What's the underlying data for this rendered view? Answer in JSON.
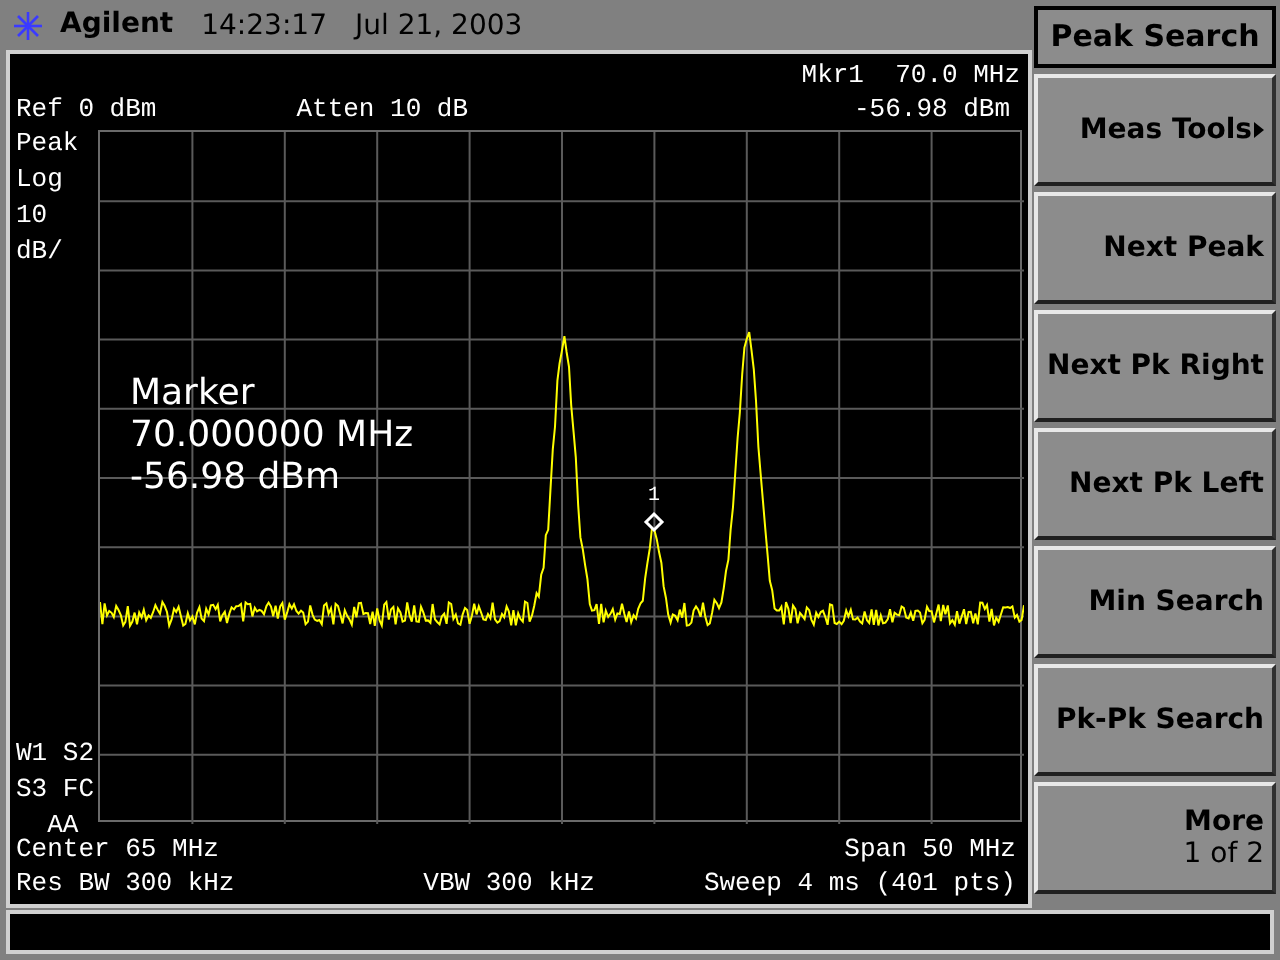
{
  "header": {
    "brand": "Agilent",
    "time": "14:23:17",
    "date": "Jul 21, 2003"
  },
  "display": {
    "marker_top": "Mkr1  70.0 MHz",
    "ref": "Ref 0 dBm",
    "atten": "Atten 10 dB",
    "marker_amplitude": "-56.98 dBm",
    "left_labels": [
      "Peak",
      "Log",
      "10",
      "dB/"
    ],
    "status_labels": [
      "W1 S2",
      "S3 FC",
      "  AA"
    ],
    "marker_readout": [
      "Marker",
      "70.000000 MHz",
      "-56.98 dBm"
    ],
    "marker": {
      "label": "1"
    },
    "center": "Center 65 MHz",
    "span": "Span 50 MHz",
    "res_bw": "Res BW 300 kHz",
    "vbw": "VBW 300 kHz",
    "sweep": "Sweep 4 ms (401 pts)"
  },
  "softkeys": {
    "title": "Peak Search",
    "keys": [
      {
        "label": "Meas Tools",
        "kind": "submenu"
      },
      {
        "label": "Next Peak",
        "kind": "plain"
      },
      {
        "label": "Next Pk Right",
        "kind": "plain"
      },
      {
        "label": "Next Pk Left",
        "kind": "plain"
      },
      {
        "label": "Min Search",
        "kind": "plain"
      },
      {
        "label": "Pk-Pk Search",
        "kind": "plain"
      },
      {
        "label": "More",
        "kind": "more",
        "sublabel": "1 of 2"
      }
    ]
  }
}
